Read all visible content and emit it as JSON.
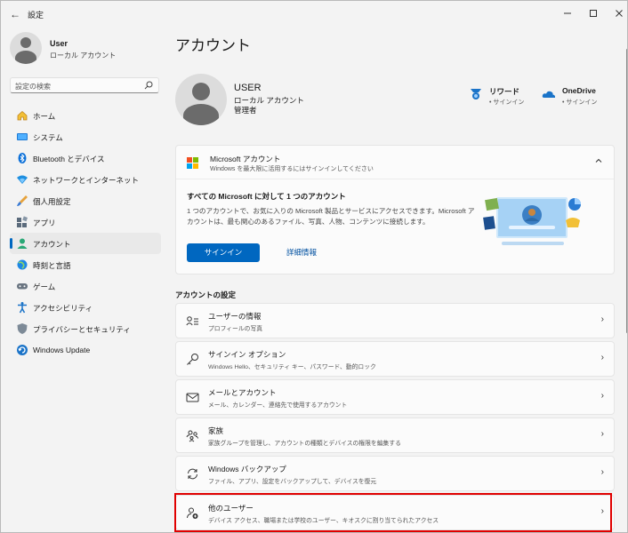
{
  "window": {
    "title": "設定",
    "back": "←",
    "minimize": "—",
    "maximize": "☐",
    "close": "✕"
  },
  "sidebar": {
    "user": {
      "name": "User",
      "type": "ローカル アカウント"
    },
    "search": {
      "placeholder": "設定の検索",
      "icon": "⌕"
    },
    "items": [
      {
        "label": "ホーム",
        "icon": "home-icon"
      },
      {
        "label": "システム",
        "icon": "system-icon"
      },
      {
        "label": "Bluetooth とデバイス",
        "icon": "bluetooth-icon"
      },
      {
        "label": "ネットワークとインターネット",
        "icon": "network-icon"
      },
      {
        "label": "個人用設定",
        "icon": "personalization-icon"
      },
      {
        "label": "アプリ",
        "icon": "apps-icon"
      },
      {
        "label": "アカウント",
        "icon": "accounts-icon",
        "active": true
      },
      {
        "label": "時刻と言語",
        "icon": "time-language-icon"
      },
      {
        "label": "ゲーム",
        "icon": "gaming-icon"
      },
      {
        "label": "アクセシビリティ",
        "icon": "accessibility-icon"
      },
      {
        "label": "プライバシーとセキュリティ",
        "icon": "privacy-icon"
      },
      {
        "label": "Windows Update",
        "icon": "windows-update-icon"
      }
    ]
  },
  "main": {
    "title": "アカウント",
    "profile": {
      "name": "USER",
      "type": "ローカル アカウント",
      "role": "管理者"
    },
    "services": [
      {
        "name": "リワード",
        "status": "• サインイン",
        "icon": "rewards-icon"
      },
      {
        "name": "OneDrive",
        "status": "• サインイン",
        "icon": "onedrive-icon"
      }
    ],
    "ms_card": {
      "title": "Microsoft アカウント",
      "subtitle": "Windows を最大限に活用するにはサインインしてください",
      "heading": "すべての Microsoft に対して 1 つのアカウント",
      "description": "1 つのアカウントで、お気に入りの Microsoft 製品とサービスにアクセスできます。Microsoft アカウントは、最も関心のあるファイル、写真、人物、コンテンツに接続します。",
      "signin": "サインイン",
      "details": "詳細情報",
      "collapse_icon": "chevron-up-icon"
    },
    "section_title": "アカウントの設定",
    "settings": [
      {
        "title": "ユーザーの情報",
        "subtitle": "プロフィールの写真",
        "icon": "user-info-icon"
      },
      {
        "title": "サインイン オプション",
        "subtitle": "Windows Hello、セキュリティ キー、パスワード、動的ロック",
        "icon": "key-icon"
      },
      {
        "title": "メールとアカウント",
        "subtitle": "メール、カレンダー、連絡先で使用するアカウント",
        "icon": "mail-icon"
      },
      {
        "title": "家族",
        "subtitle": "家族グループを管理し、アカウントの種類とデバイスの権限を編集する",
        "icon": "family-icon"
      },
      {
        "title": "Windows バックアップ",
        "subtitle": "ファイル、アプリ、設定をバックアップして、デバイスを復元",
        "icon": "backup-icon"
      },
      {
        "title": "他のユーザー",
        "subtitle": "デバイス アクセス、職場または学校のユーザー、キオスクに割り当てられたアクセス",
        "icon": "other-users-icon"
      }
    ],
    "chevron": "›"
  },
  "colors": {
    "accent": "#0067c0",
    "highlight": "#e00000",
    "background": "#f3f3f3",
    "card": "#fbfbfb"
  }
}
